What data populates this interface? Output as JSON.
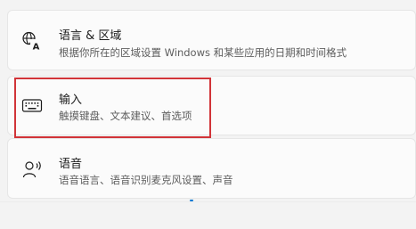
{
  "items": [
    {
      "title": "语言 & 区域",
      "subtitle": "根据你所在的区域设置 Windows 和某些应用的日期和时间格式",
      "icon": "language-icon"
    },
    {
      "title": "输入",
      "subtitle": "触摸键盘、文本建议、首选项",
      "icon": "keyboard-icon"
    },
    {
      "title": "语音",
      "subtitle": "语音语言、语音识别麦克风设置、声音",
      "icon": "speech-icon"
    }
  ],
  "colors": {
    "highlight": "#d13438",
    "accent": "#0078d4",
    "background": "#f3f3f3",
    "card": "#fbfbfb"
  }
}
